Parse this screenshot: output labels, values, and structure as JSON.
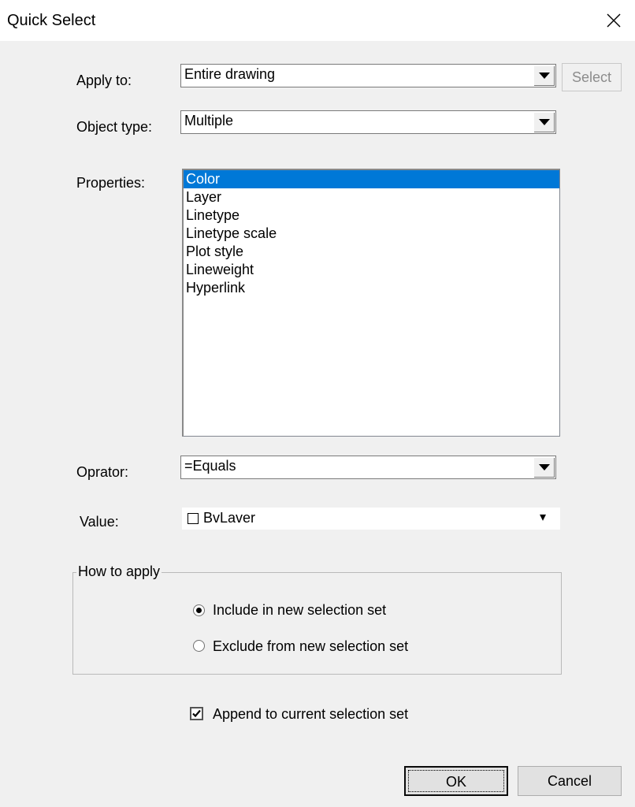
{
  "window": {
    "title": "Quick Select"
  },
  "apply_to": {
    "label": "Apply to:",
    "value": "Entire drawing",
    "select_button": "Select"
  },
  "object_type": {
    "label": "Object type:",
    "value": "Multiple"
  },
  "properties": {
    "label": "Properties:",
    "items": [
      "Color",
      "Layer",
      "Linetype",
      "Linetype scale",
      "Plot style",
      "Lineweight",
      "Hyperlink"
    ],
    "selected": "Color"
  },
  "operator": {
    "label": "Oprator:",
    "value": "=Equals"
  },
  "value": {
    "label": "Value:",
    "text": "BvLaver",
    "arrow": "▾"
  },
  "how_to_apply": {
    "title": "How to apply",
    "options": [
      "Include in new selection set",
      "Exclude from new selection set"
    ],
    "selected": "Include in new selection set"
  },
  "append": {
    "label": "Append to current selection set",
    "checked": true
  },
  "buttons": {
    "ok": "OK",
    "cancel": "Cancel"
  },
  "colors": {
    "selection": "#0078d7",
    "background": "#f0f0f0"
  }
}
